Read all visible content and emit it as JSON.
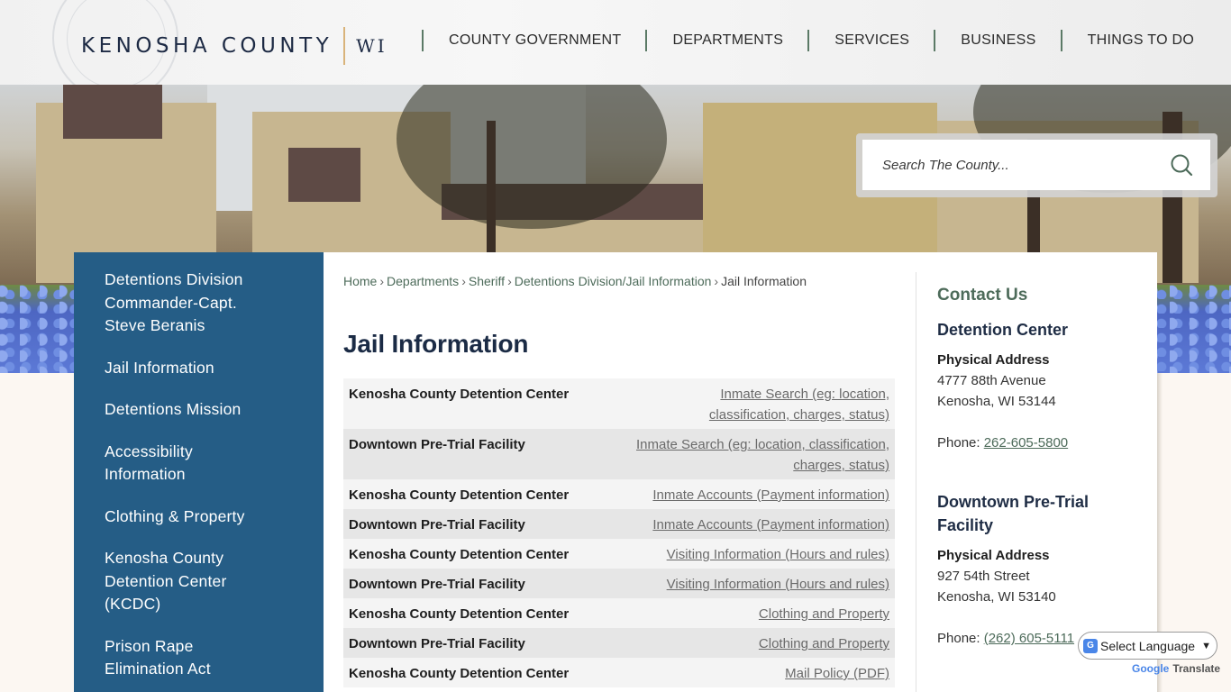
{
  "header": {
    "logo_county": "KENOSHA COUNTY",
    "logo_state": "WI",
    "nav": [
      {
        "label": "COUNTY GOVERNMENT"
      },
      {
        "label": "DEPARTMENTS"
      },
      {
        "label": "SERVICES"
      },
      {
        "label": "BUSINESS"
      },
      {
        "label": "THINGS TO DO"
      }
    ]
  },
  "search": {
    "placeholder": "Search The County...",
    "icon": "search-icon"
  },
  "sidebar": {
    "items": [
      {
        "label": "Detentions Division Commander-Capt. Steve Beranis"
      },
      {
        "label": "Jail Information"
      },
      {
        "label": "Detentions Mission"
      },
      {
        "label": "Accessibility Information"
      },
      {
        "label": "Clothing & Property"
      },
      {
        "label": "Kenosha County Detention Center (KCDC)"
      },
      {
        "label": "Prison Rape Elimination Act"
      }
    ]
  },
  "breadcrumb": {
    "items": [
      {
        "label": "Home"
      },
      {
        "label": "Departments"
      },
      {
        "label": "Sheriff"
      },
      {
        "label": "Detentions Division/Jail Information"
      }
    ],
    "separator": "›",
    "current": "Jail Information"
  },
  "page": {
    "title": "Jail Information"
  },
  "table": {
    "rows": [
      {
        "location": "Kenosha County Detention Center",
        "link": "Inmate Search (eg: location, classification, charges, status)"
      },
      {
        "location": "Downtown Pre-Trial Facility",
        "link": "Inmate Search (eg: location, classification, charges, status)"
      },
      {
        "location": "Kenosha County Detention Center",
        "link": "Inmate Accounts (Payment information)"
      },
      {
        "location": "Downtown Pre-Trial Facility",
        "link": "Inmate Accounts (Payment information)"
      },
      {
        "location": "Kenosha County Detention Center",
        "link": "Visiting Information (Hours and rules)"
      },
      {
        "location": "Downtown Pre-Trial Facility",
        "link": "Visiting Information (Hours and rules)"
      },
      {
        "location": "Kenosha County Detention Center",
        "link": "Clothing and Property"
      },
      {
        "location": "Downtown Pre-Trial Facility",
        "link": "Clothing and Property"
      },
      {
        "location": "Kenosha County Detention Center",
        "link": "Mail Policy (PDF)"
      }
    ]
  },
  "contact": {
    "heading": "Contact Us",
    "locations": [
      {
        "name": "Detention Center",
        "address_label": "Physical Address",
        "address_line1": "4777 88th Avenue",
        "address_line2": "Kenosha, WI 53144",
        "phone_label": "Phone: ",
        "phone": "262-605-5800"
      },
      {
        "name": "Downtown Pre-Trial Facility",
        "address_label": "Physical Address",
        "address_line1": "927 54th Street",
        "address_line2": "Kenosha, WI 53140",
        "phone_label": "Phone: ",
        "phone": "(262) 605-5111"
      }
    ]
  },
  "translate": {
    "select_label": "Select Language",
    "brand_google": "Google",
    "brand_translate": "Translate"
  },
  "colors": {
    "sidebar_bg": "#255d86",
    "accent_green": "#4d6b5a",
    "title_navy": "#1b2b45",
    "logo_divider": "#d9b37a"
  }
}
